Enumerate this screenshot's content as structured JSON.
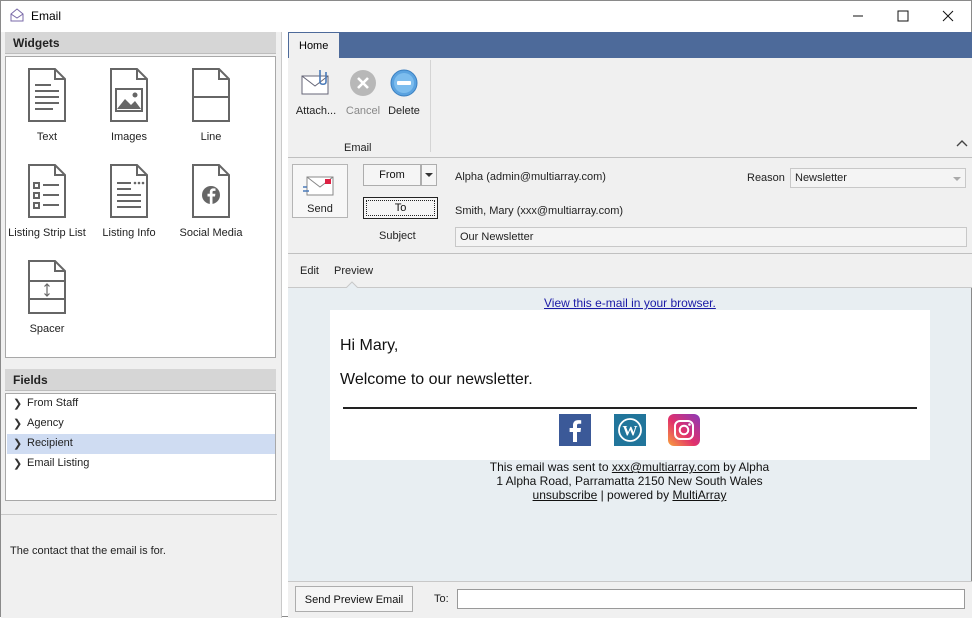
{
  "window": {
    "title": "Email",
    "minimize": "—",
    "maximize": "☐",
    "close": "✕"
  },
  "widgets": {
    "heading": "Widgets",
    "items": [
      {
        "label": "Text",
        "icon": "text-doc-icon"
      },
      {
        "label": "Images",
        "icon": "image-doc-icon"
      },
      {
        "label": "Line",
        "icon": "line-doc-icon"
      },
      {
        "label": "Listing Strip List",
        "icon": "list-doc-icon"
      },
      {
        "label": "Listing Info",
        "icon": "info-doc-icon"
      },
      {
        "label": "Social Media",
        "icon": "social-doc-icon"
      },
      {
        "label": "Spacer",
        "icon": "spacer-doc-icon"
      }
    ]
  },
  "fields": {
    "heading": "Fields",
    "items": [
      "From Staff",
      "Agency",
      "Recipient",
      "Email Listing"
    ],
    "selected": "Recipient",
    "description": "The contact that the email is for."
  },
  "ribbon": {
    "tab": "Home",
    "attach": "Attach...",
    "cancel": "Cancel",
    "delete": "Delete",
    "group": "Email"
  },
  "header": {
    "send": "Send",
    "from_btn": "From",
    "to_btn": "To",
    "subject_label": "Subject",
    "from_value": "Alpha (admin@multiarray.com)",
    "to_value": "Smith, Mary (xxx@multiarray.com)",
    "subject_value": "Our Newsletter",
    "reason_label": "Reason",
    "reason_value": "Newsletter"
  },
  "subtabs": {
    "edit": "Edit",
    "preview": "Preview"
  },
  "email": {
    "view_link": "View this e-mail in your browser.",
    "greeting": "Hi Mary,",
    "body": "Welcome to our newsletter.",
    "footer_sent_prefix": "This email was sent to ",
    "footer_email": "xxx@multiarray.com",
    "footer_sent_suffix": " by Alpha",
    "footer_address": "1 Alpha Road, Parramatta 2150 New South Wales",
    "unsubscribe": "unsubscribe",
    "powered_prefix": " | powered by ",
    "powered_link": "MultiArray"
  },
  "footer": {
    "send_preview": "Send Preview Email",
    "to_label": "To:",
    "to_value": ""
  },
  "colors": {
    "ribbon_bar": "#4d6a9a",
    "selected_row": "#cfdcf2",
    "facebook": "#3b5998",
    "wordpress": "#21759b"
  }
}
